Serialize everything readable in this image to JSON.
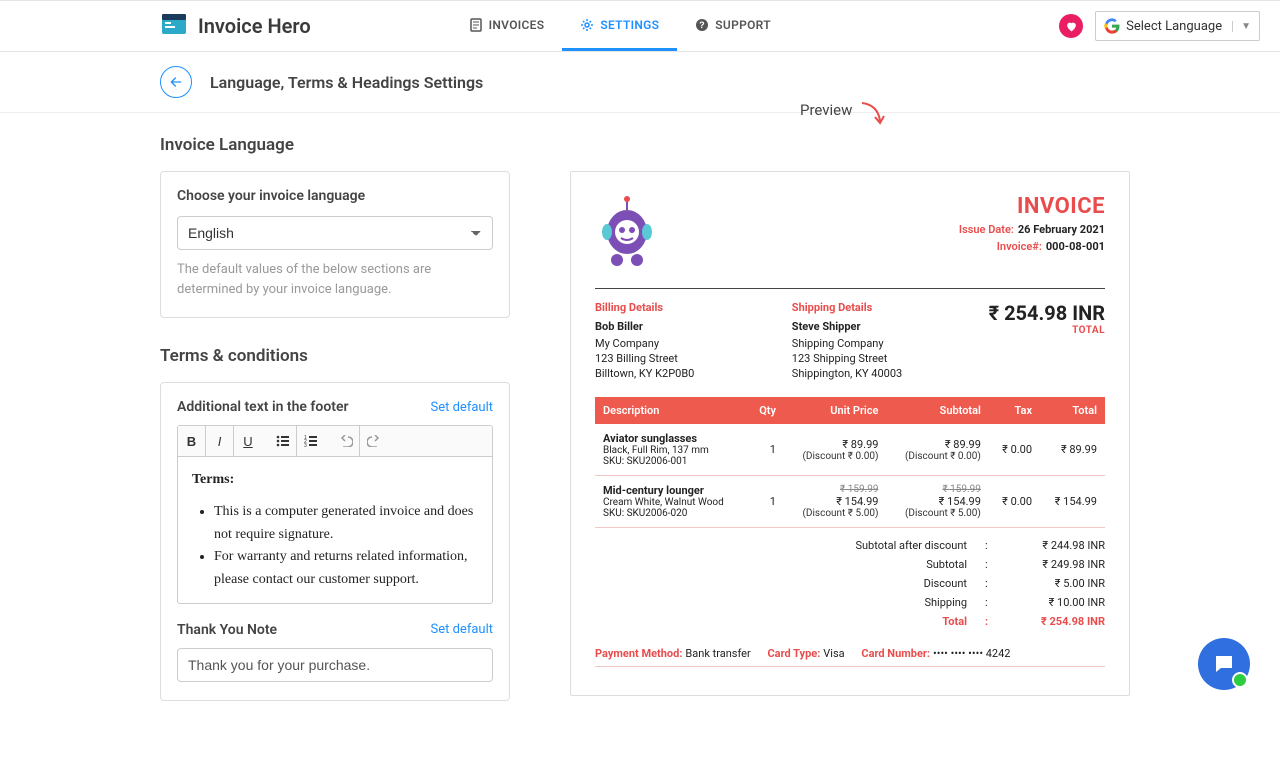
{
  "brand": {
    "title": "Invoice Hero"
  },
  "nav": {
    "invoices": "INVOICES",
    "settings": "SETTINGS",
    "support": "SUPPORT"
  },
  "langSelector": "Select Language",
  "pageTitle": "Language, Terms & Headings Settings",
  "left": {
    "invoiceLanguageHeading": "Invoice Language",
    "chooseLabel": "Choose your invoice language",
    "languageValue": "English",
    "helper": "The default values of the below sections are determined by your invoice language.",
    "termsHeading": "Terms & conditions",
    "footerLabel": "Additional text in the footer",
    "setDefault1": "Set default",
    "termsTitle": "Terms:",
    "term1": "This is a computer generated invoice and does not require signature.",
    "term2": "For warranty and returns related information, please contact our customer support.",
    "thankYouLabel": "Thank You Note",
    "setDefault2": "Set default",
    "thankYouValue": "Thank you for your purchase."
  },
  "previewLabel": "Preview",
  "invoice": {
    "title": "INVOICE",
    "issueDateLabel": "Issue Date:",
    "issueDate": "26 February 2021",
    "invoiceNumLabel": "Invoice#:",
    "invoiceNum": "000-08-001",
    "billingHeading": "Billing Details",
    "shippingHeading": "Shipping Details",
    "billing": {
      "name": "Bob Biller",
      "company": "My Company",
      "street": "123 Billing Street",
      "city": "Billtown, KY K2P0B0"
    },
    "shipping": {
      "name": "Steve Shipper",
      "company": "Shipping Company",
      "street": "123 Shipping Street",
      "city": "Shippington, KY 40003"
    },
    "grandTotal": "₹ 254.98 INR",
    "totalLabel": "TOTAL",
    "cols": {
      "desc": "Description",
      "qty": "Qty",
      "unit": "Unit Price",
      "sub": "Subtotal",
      "tax": "Tax",
      "total": "Total"
    },
    "items": [
      {
        "name": "Aviator sunglasses",
        "variant": "Black, Full Rim, 137 mm",
        "sku": "SKU: SKU2006-001",
        "qty": "1",
        "unitStrike": "",
        "unit": "₹ 89.99",
        "unitDisc": "(Discount ₹ 0.00)",
        "subStrike": "",
        "sub": "₹ 89.99",
        "subDisc": "(Discount ₹ 0.00)",
        "tax": "₹ 0.00",
        "total": "₹ 89.99"
      },
      {
        "name": "Mid-century lounger",
        "variant": "Cream White, Walnut Wood",
        "sku": "SKU: SKU2006-020",
        "qty": "1",
        "unitStrike": "₹ 159.99",
        "unit": "₹ 154.99",
        "unitDisc": "(Discount ₹ 5.00)",
        "subStrike": "₹ 159.99",
        "sub": "₹ 154.99",
        "subDisc": "(Discount ₹ 5.00)",
        "tax": "₹ 0.00",
        "total": "₹ 154.99"
      }
    ],
    "summary": {
      "subAfterDiscLabel": "Subtotal after discount",
      "subAfterDisc": "₹ 244.98 INR",
      "subtotalLabel": "Subtotal",
      "subtotal": "₹ 249.98 INR",
      "discountLabel": "Discount",
      "discount": "₹ 5.00 INR",
      "shippingLabel": "Shipping",
      "shipping": "₹ 10.00 INR",
      "totalLabel": "Total",
      "total": "₹ 254.98 INR"
    },
    "payment": {
      "methodLabel": "Payment Method:",
      "method": "Bank transfer",
      "cardTypeLabel": "Card Type:",
      "cardType": "Visa",
      "cardNumLabel": "Card Number:",
      "cardNum": "•••• •••• •••• 4242"
    }
  }
}
